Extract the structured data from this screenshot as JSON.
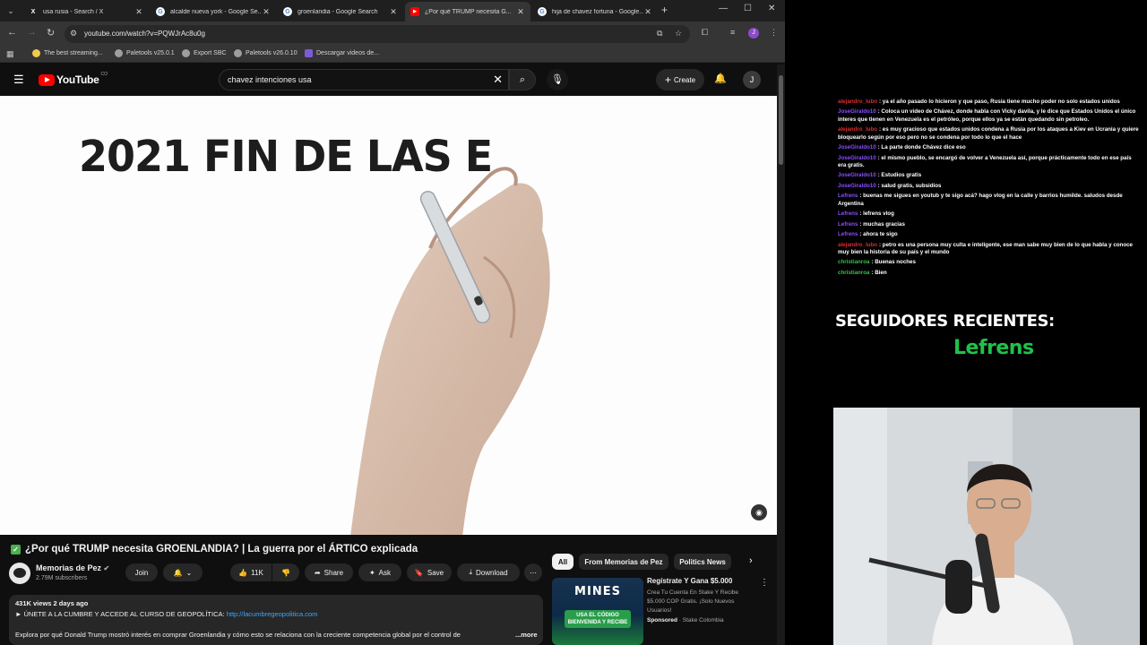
{
  "browser": {
    "tabs": [
      {
        "title": "usa rusia - Search / X",
        "icon": "x-icon",
        "active": false
      },
      {
        "title": "alcalde nueva york - Google Se...",
        "icon": "google-icon",
        "active": false
      },
      {
        "title": "groenlandia - Google Search",
        "icon": "google-icon",
        "active": false
      },
      {
        "title": "¿Por qué TRUMP necesita G...",
        "icon": "youtube-icon",
        "active": true
      },
      {
        "title": "hija de chavez fortuna - Google...",
        "icon": "google-icon",
        "active": false
      }
    ],
    "url": "youtube.com/watch?v=PQWJrAc8u0g",
    "bookmarks": [
      {
        "label": "The best streaming...",
        "color": "#f2c94c"
      },
      {
        "label": "Paletools v25.0.1",
        "color": "#9e9e9e"
      },
      {
        "label": "Export SBC",
        "color": "#9e9e9e"
      },
      {
        "label": "Paletools v26.0.10",
        "color": "#9e9e9e"
      },
      {
        "label": "Descargar videos de...",
        "color": "#7b5cd6"
      }
    ]
  },
  "youtube": {
    "logo_text": "YouTube",
    "logo_country": "CO",
    "search_value": "chavez intenciones usa",
    "create_label": "Create",
    "avatar_letter": "J",
    "video_frame_text": "2021 FIN DE LAS E",
    "video_title": "¿Por qué TRUMP necesita GROENLANDIA? | La guerra por el ÁRTICO explicada",
    "channel_name": "Memorias de Pez",
    "subscribers": "2.79M subscribers",
    "join_label": "Join",
    "likes": "11K",
    "share_label": "Share",
    "ask_label": "Ask",
    "save_label": "Save",
    "download_label": "Download",
    "views_line": "431K views  2 days ago",
    "desc_line1": "► ÚNETE A LA CUMBRE Y ACCEDE AL CURSO DE GEOPOLÍTICA: ",
    "desc_link": "http://lacumbregeopolitica.com",
    "desc_line2": "Explora por qué Donald Trump mostró interés en comprar Groenlandia y cómo esto se relaciona con la creciente competencia global por el control de",
    "more_label": "...more",
    "chips": [
      "All",
      "From Memorias de Pez",
      "Politics News"
    ],
    "ad": {
      "brand": "MINES",
      "promo": "USA EL CÓDIGO BIENVENIDA Y RECIBE",
      "title": "Regístrate Y Gana $5.000",
      "desc": "Crea Tu Cuenta En Stake Y Recibe $5.000 COP Gratis. ¡Solo Nuevos Usuarios!",
      "sponsored": "Sponsored",
      "advertiser": "· Stake Colombia"
    }
  },
  "stream": {
    "chat": [
      {
        "user": "alejandro_lubo",
        "color": "#d62f2f",
        "text": ": ya el año pasado lo hicieron y que paso, Rusia tiene mucho poder no solo estados unidos"
      },
      {
        "user": "JoseGiraldo10",
        "color": "#8a4dff",
        "text": ": Coloca un video de Chávez, donde habla con Vicky davila, y le dice que Estados Unidos el único interes que tienen en Venezuela es el petróleo, porque ellos ya se están quedando sin petroleo."
      },
      {
        "user": "alejandro_lubo",
        "color": "#d62f2f",
        "text": ": es muy gracioso que estados unidos condena a Rusia por los ataques a Kiev en Ucrania y quiere bloquearlo según por eso pero no se condena por todo lo que el hace"
      },
      {
        "user": "JoseGiraldo10",
        "color": "#8a4dff",
        "text": ": La parte donde Chávez dice eso"
      },
      {
        "user": "JoseGiraldo10",
        "color": "#8a4dff",
        "text": ": el mismo pueblo, se encargó de volver a Venezuela así, porque prácticamente todo en ese país era gratis."
      },
      {
        "user": "JoseGiraldo10",
        "color": "#8a4dff",
        "text": ": Estudios gratis"
      },
      {
        "user": "JoseGiraldo10",
        "color": "#8a4dff",
        "text": ": salud gratis, subsidios"
      },
      {
        "user": "Lefrens",
        "color": "#8a4dff",
        "text": ": buenas me sigues en youtub y te sigo acá? hago vlog en la calle y barrios humilde. saludos desde Argentina"
      },
      {
        "user": "Lefrens",
        "color": "#8a4dff",
        "text": ": lefrens vlog"
      },
      {
        "user": "Lefrens",
        "color": "#8a4dff",
        "text": ": muchas gracias"
      },
      {
        "user": "Lefrens",
        "color": "#8a4dff",
        "text": ": ahora te sigo"
      },
      {
        "user": "alejandro_lubo",
        "color": "#d62f2f",
        "text": ": petro es una persona muy culta e inteligente, ese man sabe muy bien de lo que habla y conoce muy bien la historia de su país y el mundo"
      },
      {
        "user": "christianroa",
        "color": "#34c24a",
        "text": ": Buenas noches"
      },
      {
        "user": "christianroa",
        "color": "#34c24a",
        "text": ": Bien"
      }
    ],
    "followers_title": "SEGUIDORES RECIENTES:",
    "recent_follower": "Lefrens"
  }
}
